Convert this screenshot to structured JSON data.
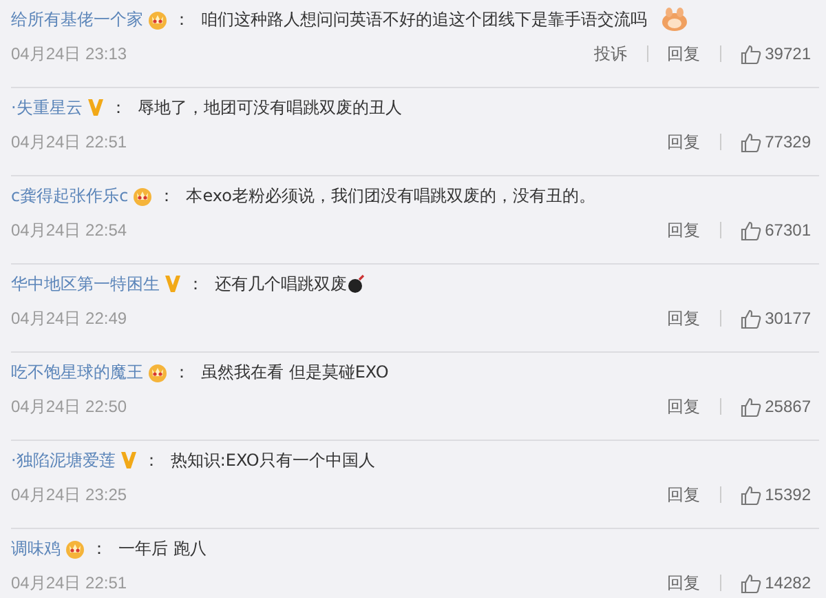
{
  "comments": [
    {
      "user": "给所有基佬一个家",
      "badge": {
        "kind": "crown"
      },
      "colon": "：",
      "text": "咱们这种路人想问问英语不好的追这个团线下是靠手语交流吗",
      "emoji": {
        "kind": "hands"
      },
      "time": "04月24日 23:13",
      "actions": [
        "投诉",
        "回复"
      ],
      "likes": "39721"
    },
    {
      "user": "·失重星云",
      "badge": {
        "kind": "v"
      },
      "colon": "：",
      "text": "辱地了，地团可没有唱跳双废的丑人",
      "time": "04月24日 22:51",
      "actions": [
        "回复"
      ],
      "likes": "77329"
    },
    {
      "user": "c龚得起张作乐c",
      "badge": {
        "kind": "crown"
      },
      "colon": "：",
      "text": "本exo老粉必须说，我们团没有唱跳双废的，没有丑的。",
      "time": "04月24日 22:54",
      "actions": [
        "回复"
      ],
      "likes": "67301"
    },
    {
      "user": "华中地区第一特困生",
      "badge": {
        "kind": "v"
      },
      "colon": "：",
      "text": "还有几个唱跳双废",
      "emoji": {
        "kind": "bomb"
      },
      "time": "04月24日 22:49",
      "actions": [
        "回复"
      ],
      "likes": "30177"
    },
    {
      "user": "吃不饱星球的魔王",
      "badge": {
        "kind": "crown"
      },
      "colon": "：",
      "text": "虽然我在看 但是莫碰EXO",
      "time": "04月24日 22:50",
      "actions": [
        "回复"
      ],
      "likes": "25867"
    },
    {
      "user": "·独陷泥塘爱莲",
      "badge": {
        "kind": "v"
      },
      "colon": "：",
      "text": "热知识:EXO只有一个中国人",
      "time": "04月24日 23:25",
      "actions": [
        "回复"
      ],
      "likes": "15392"
    },
    {
      "user": "调味鸡",
      "badge": {
        "kind": "crown"
      },
      "colon": "：",
      "text": "一年后 跑八",
      "time": "04月24日 22:51",
      "actions": [
        "回复"
      ],
      "likes": "14282"
    }
  ]
}
